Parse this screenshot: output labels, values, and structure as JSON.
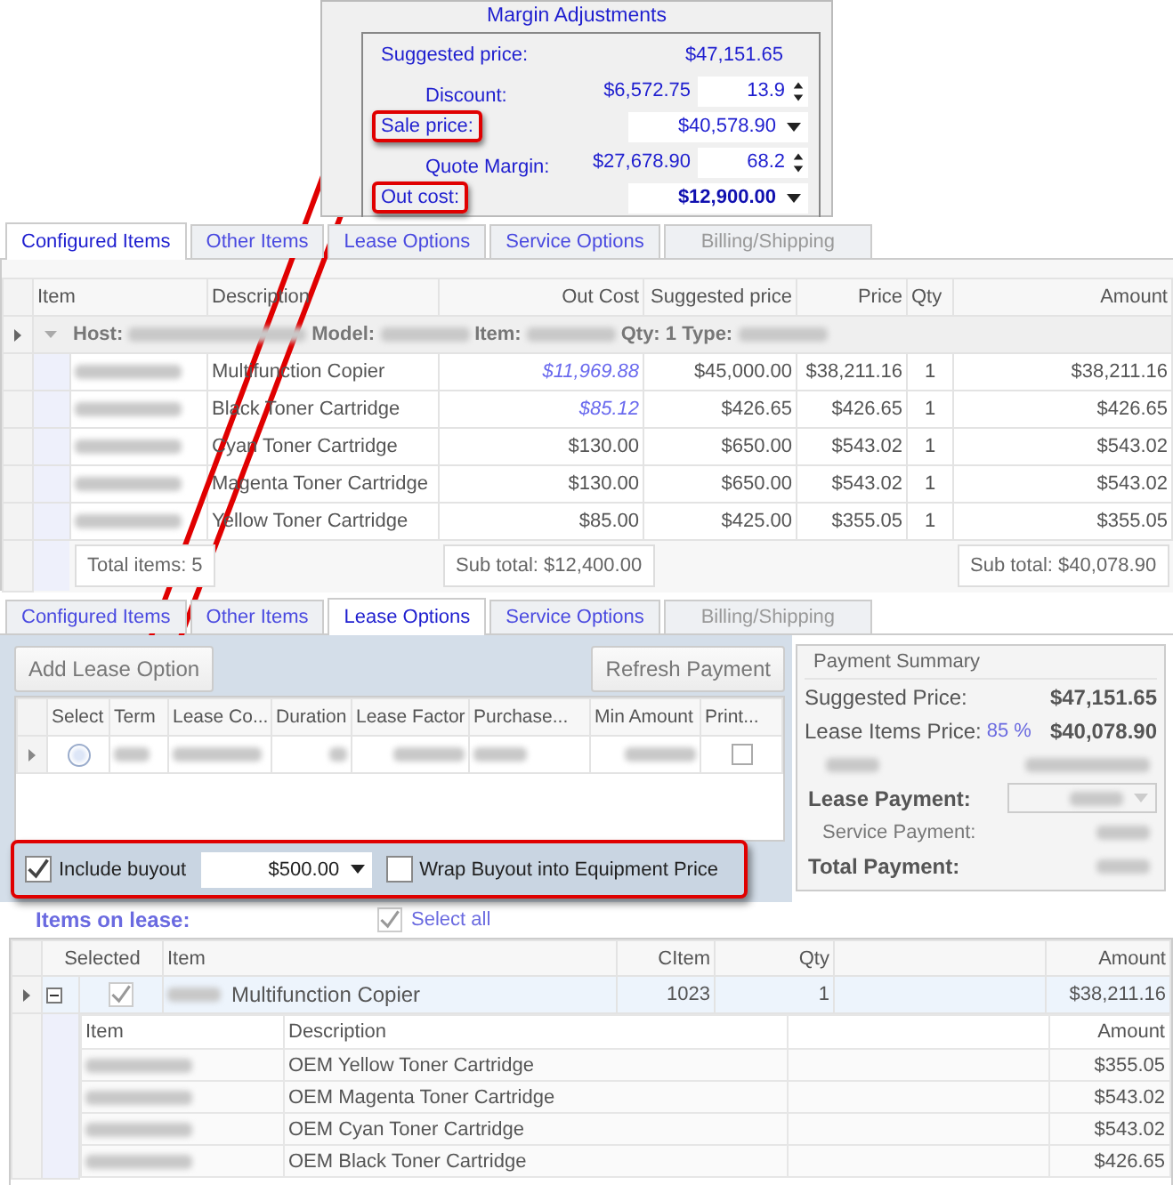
{
  "margin_adjustments": {
    "title": "Margin Adjustments",
    "suggested_price": {
      "label": "Suggested price:",
      "value": "$47,151.65"
    },
    "discount": {
      "label": "Discount:",
      "amount": "$6,572.75",
      "percent": "13.9"
    },
    "sale_price": {
      "label": "Sale price:",
      "value": "$40,578.90",
      "highlighted": true
    },
    "quote_margin": {
      "label": "Quote Margin:",
      "amount": "$27,678.90",
      "percent": "68.2"
    },
    "out_cost": {
      "label": "Out cost:",
      "value": "$12,900.00",
      "highlighted": true
    }
  },
  "top_tabs": [
    {
      "label": "Configured Items",
      "selected": true,
      "disabled": false
    },
    {
      "label": "Other Items",
      "selected": false,
      "disabled": false
    },
    {
      "label": "Lease Options",
      "selected": false,
      "disabled": false
    },
    {
      "label": "Service Options",
      "selected": false,
      "disabled": false
    },
    {
      "label": "Billing/Shipping",
      "selected": false,
      "disabled": true
    }
  ],
  "configured_grid": {
    "columns": [
      "Item",
      "Description",
      "Out Cost",
      "Suggested price",
      "Price",
      "Qty",
      "Amount"
    ],
    "group_row": {
      "labels": [
        "Host:",
        "Model:",
        "Item:",
        "Qty: 1 Type:"
      ]
    },
    "rows": [
      {
        "description": "Multifunction Copier",
        "out_cost": "$11,969.88",
        "out_cost_overridden": true,
        "suggested_price": "$45,000.00",
        "price": "$38,211.16",
        "qty": "1",
        "amount": "$38,211.16"
      },
      {
        "description": "Black Toner Cartridge",
        "out_cost": "$85.12",
        "out_cost_overridden": true,
        "suggested_price": "$426.65",
        "price": "$426.65",
        "qty": "1",
        "amount": "$426.65"
      },
      {
        "description": "Cyan Toner Cartridge",
        "out_cost": "$130.00",
        "out_cost_overridden": false,
        "suggested_price": "$650.00",
        "price": "$543.02",
        "qty": "1",
        "amount": "$543.02"
      },
      {
        "description": "Magenta Toner Cartridge",
        "out_cost": "$130.00",
        "out_cost_overridden": false,
        "suggested_price": "$650.00",
        "price": "$543.02",
        "qty": "1",
        "amount": "$543.02"
      },
      {
        "description": "Yellow Toner Cartridge",
        "out_cost": "$85.00",
        "out_cost_overridden": false,
        "suggested_price": "$425.00",
        "price": "$355.05",
        "qty": "1",
        "amount": "$355.05"
      }
    ],
    "footer": {
      "total_items": "Total items: 5",
      "out_cost_subtotal": "Sub total: $12,400.00",
      "amount_subtotal": "Sub total: $40,078.90"
    }
  },
  "lease_tabs": [
    {
      "label": "Configured Items",
      "selected": false,
      "disabled": false
    },
    {
      "label": "Other Items",
      "selected": false,
      "disabled": false
    },
    {
      "label": "Lease Options",
      "selected": true,
      "disabled": false
    },
    {
      "label": "Service Options",
      "selected": false,
      "disabled": false
    },
    {
      "label": "Billing/Shipping",
      "selected": false,
      "disabled": true
    }
  ],
  "lease_options": {
    "buttons": [
      "Add Lease Option",
      "Refresh Payment"
    ],
    "columns": [
      "Select",
      "Term",
      "Lease Co...",
      "Duration",
      "Lease Factor",
      "Purchase...",
      "Min Amount",
      "Print..."
    ],
    "rows": [
      {
        "selected": false,
        "print": false
      }
    ],
    "buyout": {
      "highlighted": true,
      "include": {
        "label": "Include buyout",
        "checked": true
      },
      "amount": "$500.00",
      "wrap": {
        "label": "Wrap Buyout into Equipment Price",
        "checked": false
      }
    }
  },
  "payment_summary": {
    "title": "Payment Summary",
    "suggested_price": {
      "label": "Suggested Price:",
      "value": "$47,151.65"
    },
    "lease_items_price": {
      "label": "Lease Items Price:",
      "percent": "85 %",
      "value": "$40,078.90"
    },
    "lease_payment": {
      "label": "Lease Payment:"
    },
    "service_payment": {
      "label": "Service Payment:"
    },
    "total_payment": {
      "label": "Total Payment:"
    }
  },
  "items_on_lease": {
    "title": "Items on lease:",
    "select_all": {
      "label": "Select all",
      "checked": true
    },
    "columns": [
      "Selected",
      "Item",
      "CItem",
      "Qty",
      "Amount"
    ],
    "rows": [
      {
        "expanded": true,
        "selected": true,
        "item": "Multifunction Copier",
        "citem": "1023",
        "qty": "1",
        "amount": "$38,211.16",
        "child_columns": [
          "Item",
          "Description",
          "Amount"
        ],
        "children": [
          {
            "description": "OEM Yellow Toner Cartridge",
            "amount": "$355.05"
          },
          {
            "description": "OEM Magenta Toner Cartridge",
            "amount": "$543.02"
          },
          {
            "description": "OEM Cyan Toner Cartridge",
            "amount": "$543.02"
          },
          {
            "description": "OEM Black Toner Cartridge",
            "amount": "$426.65"
          }
        ]
      }
    ]
  }
}
